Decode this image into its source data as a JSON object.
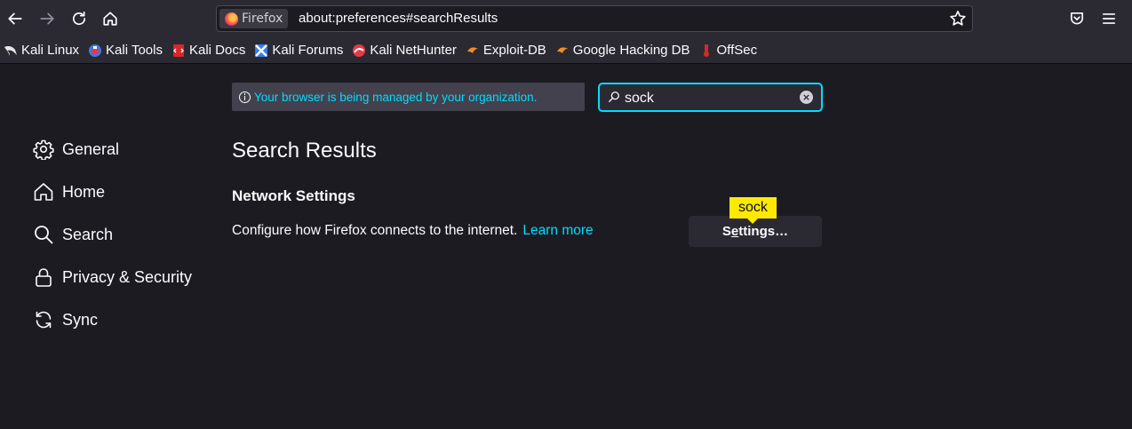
{
  "toolbar": {
    "identity_label": "Firefox",
    "url": "about:preferences#searchResults"
  },
  "bookmarks": [
    {
      "label": "Kali Linux",
      "icon": "kali-dragon-icon"
    },
    {
      "label": "Kali Tools",
      "icon": "kali-tools-icon"
    },
    {
      "label": "Kali Docs",
      "icon": "kali-docs-icon"
    },
    {
      "label": "Kali Forums",
      "icon": "kali-forums-icon"
    },
    {
      "label": "Kali NetHunter",
      "icon": "kali-nethunter-icon"
    },
    {
      "label": "Exploit-DB",
      "icon": "exploit-db-icon"
    },
    {
      "label": "Google Hacking DB",
      "icon": "ghdb-icon"
    },
    {
      "label": "OffSec",
      "icon": "offsec-icon"
    }
  ],
  "notice": {
    "text": "Your browser is being managed by your organization."
  },
  "search": {
    "value": "sock"
  },
  "sidebar": {
    "items": [
      {
        "label": "General",
        "icon": "gear-icon"
      },
      {
        "label": "Home",
        "icon": "home-icon"
      },
      {
        "label": "Search",
        "icon": "search-icon"
      },
      {
        "label": "Privacy & Security",
        "icon": "lock-icon"
      },
      {
        "label": "Sync",
        "icon": "sync-icon"
      }
    ]
  },
  "main": {
    "results_title": "Search Results",
    "section_title": "Network Settings",
    "description": "Configure how Firefox connects to the internet.",
    "learn_more": "Learn more",
    "settings_button": {
      "before": "S",
      "underlined": "e",
      "after": "ttings…"
    },
    "tooltip": "sock"
  },
  "colors": {
    "background": "#1c1b22",
    "toolbar": "#2b2a33",
    "accent": "#00ddff",
    "highlight": "#ffe900"
  }
}
